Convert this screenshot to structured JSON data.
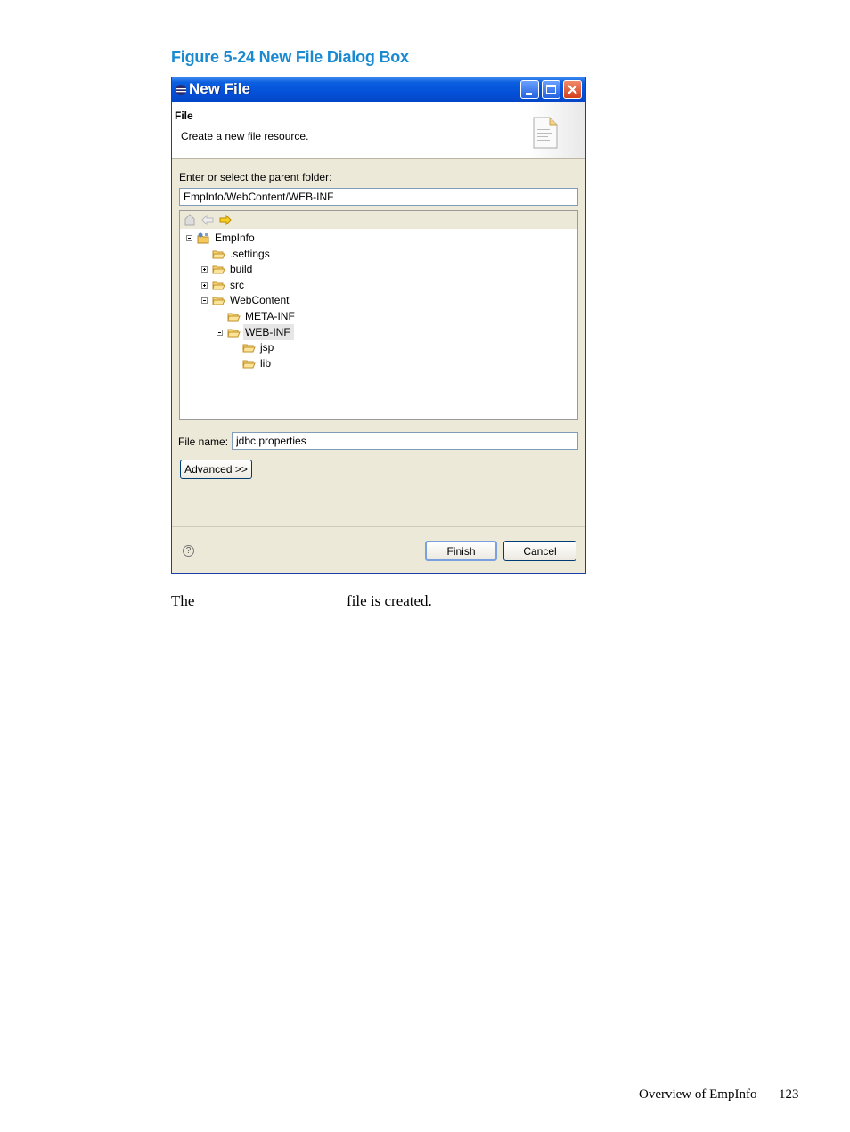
{
  "figure": {
    "caption": "Figure 5-24 New File Dialog Box"
  },
  "dialog": {
    "title": "New File",
    "header": {
      "title": "File",
      "description": "Create a new file resource."
    },
    "parent_folder": {
      "label": "Enter or select the parent folder:",
      "value": "EmpInfo/WebContent/WEB-INF"
    },
    "tree": [
      {
        "label": "EmpInfo",
        "level": 0,
        "expander": "minus",
        "icon": "project-icon"
      },
      {
        "label": ".settings",
        "level": 1,
        "expander": "none",
        "icon": "folder-icon"
      },
      {
        "label": "build",
        "level": 1,
        "expander": "plus",
        "icon": "folder-icon"
      },
      {
        "label": "src",
        "level": 1,
        "expander": "plus",
        "icon": "folder-icon"
      },
      {
        "label": "WebContent",
        "level": 1,
        "expander": "minus",
        "icon": "folder-icon"
      },
      {
        "label": "META-INF",
        "level": 2,
        "expander": "none",
        "icon": "folder-icon"
      },
      {
        "label": "WEB-INF",
        "level": 2,
        "expander": "minus",
        "icon": "folder-icon",
        "selected": true
      },
      {
        "label": "jsp",
        "level": 3,
        "expander": "none",
        "icon": "folder-icon"
      },
      {
        "label": "lib",
        "level": 3,
        "expander": "none",
        "icon": "folder-icon"
      }
    ],
    "file_name": {
      "label": "File name:",
      "value": "jdbc.properties"
    },
    "advanced_label": "Advanced >>",
    "finish_label": "Finish",
    "cancel_label": "Cancel"
  },
  "body": {
    "text_before": "The",
    "text_after": "file is created."
  },
  "footer": {
    "section": "Overview of EmpInfo",
    "page": "123"
  }
}
